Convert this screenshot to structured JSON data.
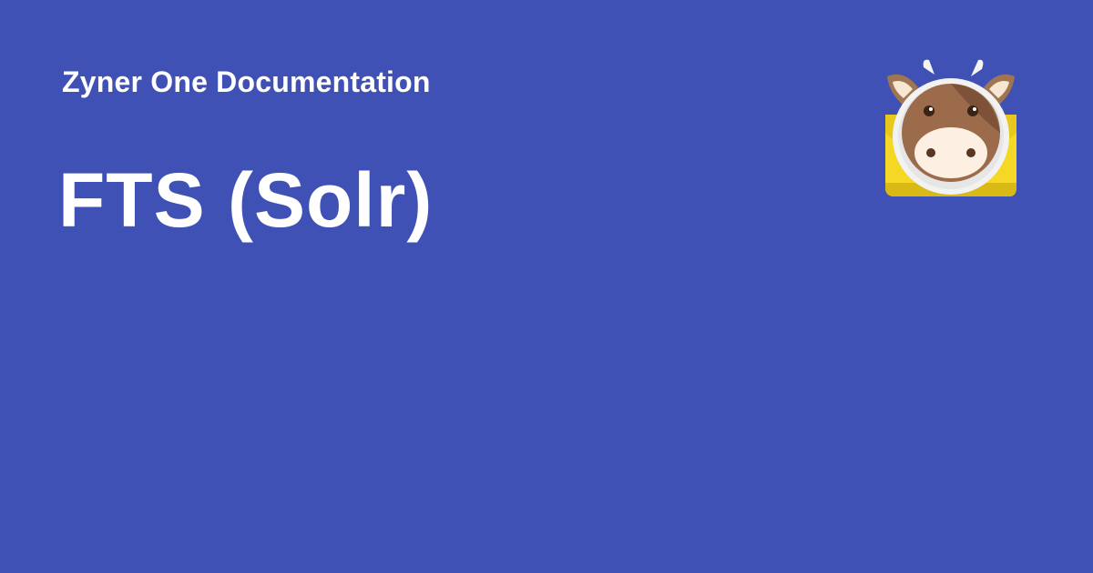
{
  "header": {
    "site_name": "Zyner One Documentation",
    "logo_icon": "cow-mail-logo-icon"
  },
  "main": {
    "title": "FTS (Solr)"
  },
  "colors": {
    "background": "#3f51b5",
    "text": "#ffffff",
    "logo_envelope": "#f5d725",
    "logo_cow_face": "#9c6b4c",
    "logo_muzzle": "#fdf0e2"
  }
}
